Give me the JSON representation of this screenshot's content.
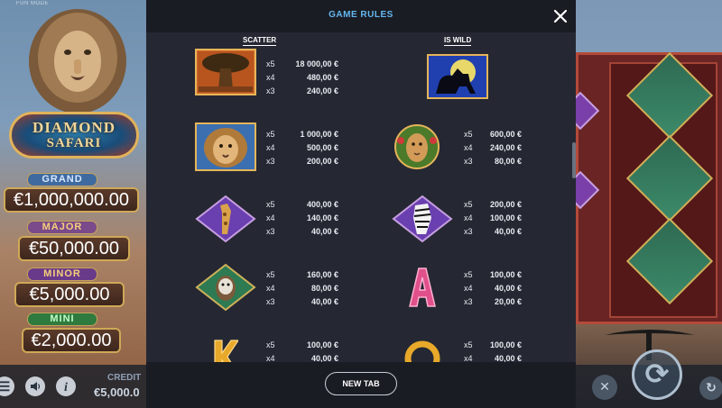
{
  "game": {
    "mode_label": "FUN MODE",
    "logo_line1": "DIAMOND",
    "logo_line2": "SAFARI",
    "jackpots": [
      {
        "name": "GRAND",
        "value": "€1,000,000.00"
      },
      {
        "name": "MAJOR",
        "value": "€50,000.00"
      },
      {
        "name": "MINOR",
        "value": "€5,000.00"
      },
      {
        "name": "MINI",
        "value": "€2,000.00"
      }
    ],
    "credit_label": "CREDIT",
    "credit_value": "€5,000.0",
    "menu_icon": "menu-icon",
    "sound_icon": "speaker-icon",
    "info_icon": "info-icon",
    "spin_icon": "spin-icon",
    "autoplay_icon": "autoplay-icon",
    "turbo_icon": "turbo-icon"
  },
  "modal": {
    "title": "GAME RULES",
    "close_icon": "close-icon",
    "scatter_header": "SCATTER",
    "wild_header": "IS WILD",
    "footer_button": "NEW TAB",
    "paytable": [
      {
        "symbol": "baobab-tree-scatter",
        "column": "left",
        "pays": [
          {
            "mult": "x5",
            "amount": "18 000,00 €"
          },
          {
            "mult": "x4",
            "amount": "480,00 €"
          },
          {
            "mult": "x3",
            "amount": "240,00 €"
          }
        ]
      },
      {
        "symbol": "lion-silhouette-wild",
        "column": "right",
        "pays": []
      },
      {
        "symbol": "lion",
        "column": "left",
        "pays": [
          {
            "mult": "x5",
            "amount": "1 000,00 €"
          },
          {
            "mult": "x4",
            "amount": "500,00 €"
          },
          {
            "mult": "x3",
            "amount": "200,00 €"
          }
        ]
      },
      {
        "symbol": "lioness",
        "column": "right",
        "pays": [
          {
            "mult": "x5",
            "amount": "600,00 €"
          },
          {
            "mult": "x4",
            "amount": "240,00 €"
          },
          {
            "mult": "x3",
            "amount": "80,00 €"
          }
        ]
      },
      {
        "symbol": "giraffe",
        "column": "left",
        "pays": [
          {
            "mult": "x5",
            "amount": "400,00 €"
          },
          {
            "mult": "x4",
            "amount": "140,00 €"
          },
          {
            "mult": "x3",
            "amount": "40,00 €"
          }
        ]
      },
      {
        "symbol": "zebra",
        "column": "right",
        "pays": [
          {
            "mult": "x5",
            "amount": "200,00 €"
          },
          {
            "mult": "x4",
            "amount": "100,00 €"
          },
          {
            "mult": "x3",
            "amount": "40,00 €"
          }
        ]
      },
      {
        "symbol": "monkey",
        "column": "left",
        "pays": [
          {
            "mult": "x5",
            "amount": "160,00 €"
          },
          {
            "mult": "x4",
            "amount": "80,00 €"
          },
          {
            "mult": "x3",
            "amount": "40,00 €"
          }
        ]
      },
      {
        "symbol": "letter-a",
        "column": "right",
        "pays": [
          {
            "mult": "x5",
            "amount": "100,00 €"
          },
          {
            "mult": "x4",
            "amount": "40,00 €"
          },
          {
            "mult": "x3",
            "amount": "20,00 €"
          }
        ]
      },
      {
        "symbol": "letter-k",
        "column": "left",
        "pays": [
          {
            "mult": "x5",
            "amount": "100,00 €"
          },
          {
            "mult": "x4",
            "amount": "40,00 €"
          }
        ]
      },
      {
        "symbol": "letter-q",
        "column": "right",
        "pays": [
          {
            "mult": "x5",
            "amount": "100,00 €"
          },
          {
            "mult": "x4",
            "amount": "40,00 €"
          }
        ]
      }
    ]
  },
  "colors": {
    "modal_bg": "#252833",
    "title_blue": "#64b7f0",
    "diamond_purple": "#7a3fa8",
    "diamond_green": "#3c8a6a",
    "letter_pink": "#e0508a",
    "letter_gold": "#e8a92a"
  }
}
